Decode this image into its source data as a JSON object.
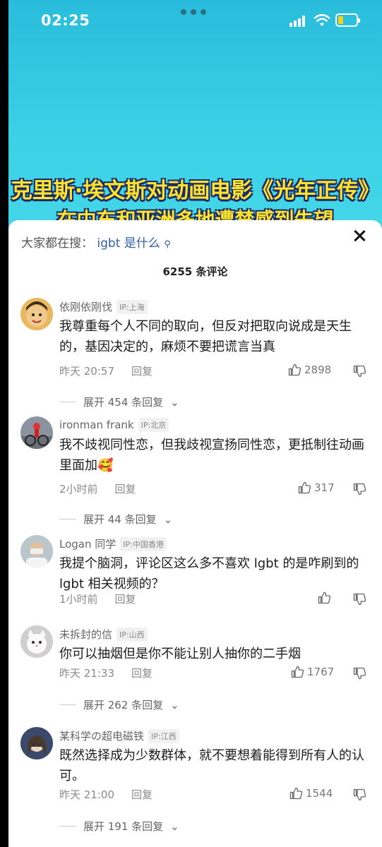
{
  "status_bar": {
    "time": "02:25",
    "battery_level": 0.3
  },
  "video": {
    "headline_line1": "克里斯·埃文斯对动画电影《光年正传》",
    "headline_line2": "在中东和亚洲多地遭禁感到失望"
  },
  "sheet": {
    "search_prefix": "大家都在搜：",
    "search_keyword": "igbt 是什么",
    "comment_count": "6255 条评论"
  },
  "comments": [
    {
      "name": "依刚依刚伐",
      "ip": "IP:上海",
      "text": "我尊重每个人不同的取向，但反对把取向说成是天生的，基因决定的，麻烦不要把谎言当真",
      "time": "昨天 20:57",
      "reply": "回复",
      "likes": "2898",
      "expand": "展开 454 条回复"
    },
    {
      "name": "ironman frank",
      "ip": "IP:北京",
      "text": "我不歧视同性恋，但我歧视宣扬同性恋，更抵制往动画里面加🥰",
      "time": "2小时前",
      "reply": "回复",
      "likes": "317",
      "expand": "展开 44 条回复"
    },
    {
      "name": "Logan 同学",
      "ip": "IP:中国香港",
      "text": "我提个脑洞，评论区这么多不喜欢 lgbt 的是咋刷到的 lgbt 相关视频的？",
      "time": "1小时前",
      "reply": "回复",
      "likes": "",
      "expand": ""
    },
    {
      "name": "未拆封的信",
      "ip": "IP:山西",
      "text": "你可以抽烟但是你不能让别人抽你的二手烟",
      "time": "昨天 21:33",
      "reply": "回复",
      "likes": "1767",
      "expand": "展开 262 条回复"
    },
    {
      "name": "某科学の超电磁铁",
      "ip": "IP:江西",
      "text": "既然选择成为少数群体，就不要想着能得到所有人的认可。",
      "time": "昨天 21:00",
      "reply": "回复",
      "likes": "1544",
      "expand": "展开 191 条回复"
    }
  ]
}
